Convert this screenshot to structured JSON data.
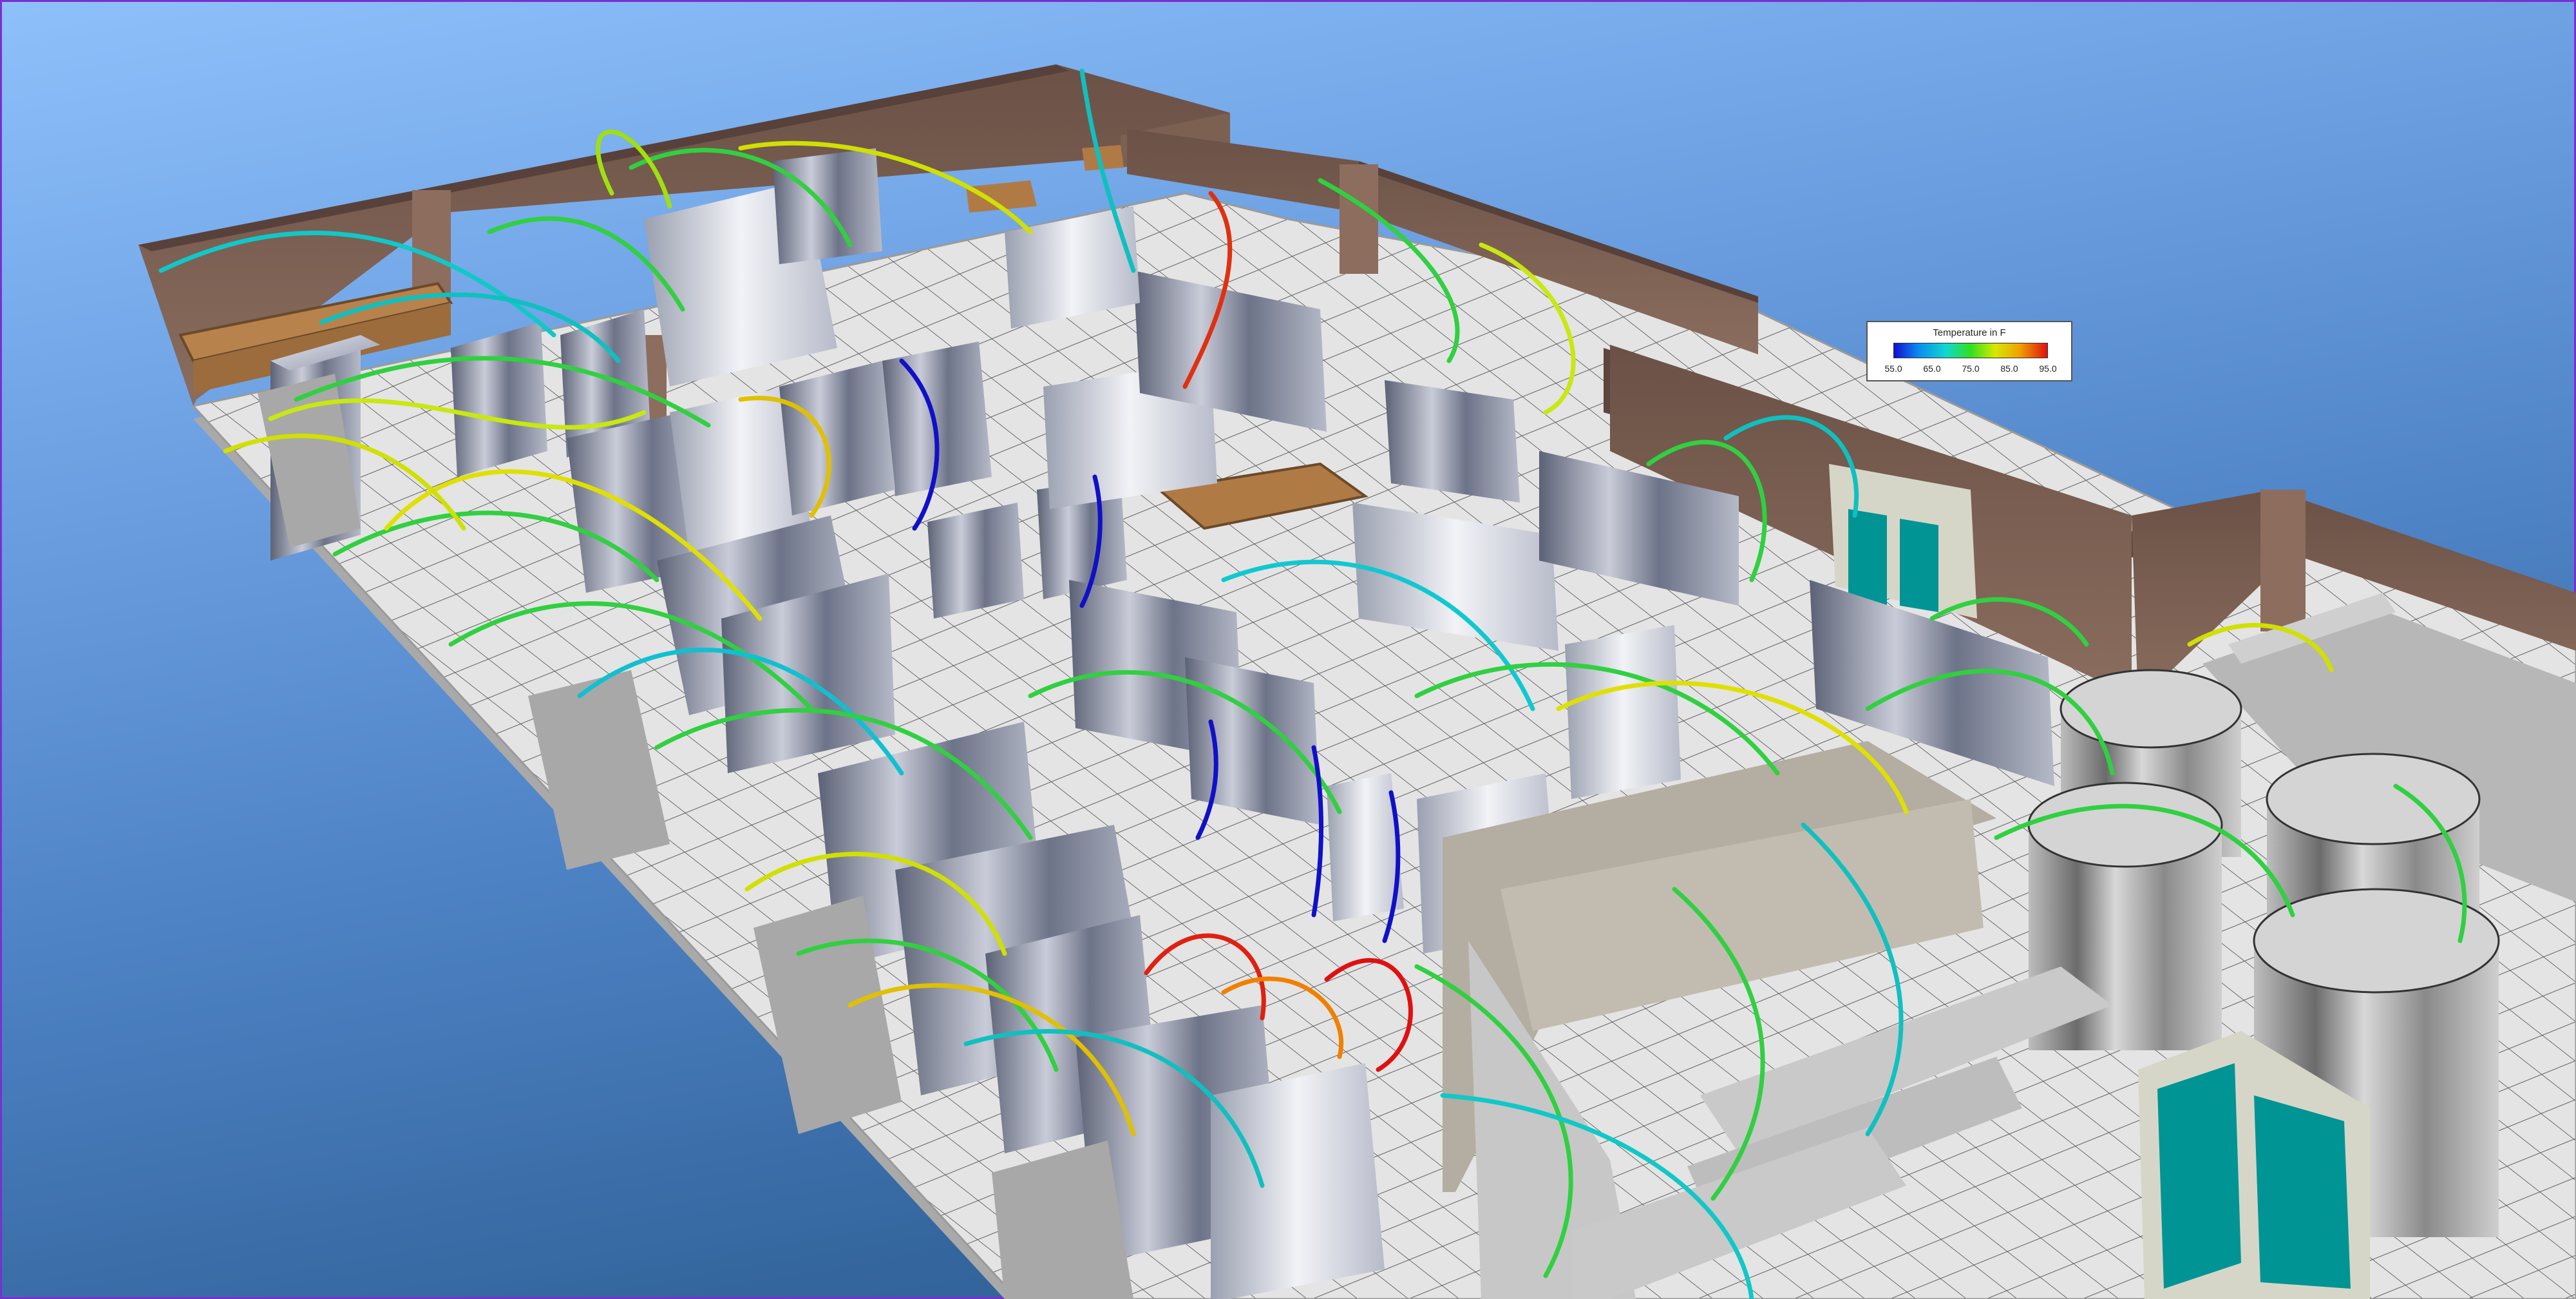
{
  "legend": {
    "title": "Temperature in F",
    "ticks": [
      "55.0",
      "65.0",
      "75.0",
      "85.0",
      "95.0"
    ],
    "range": [
      55.0,
      95.0
    ],
    "colors": [
      "#1010d0",
      "#0a8cf0",
      "#10d8d0",
      "#30e020",
      "#d8e800",
      "#f0a000",
      "#e01010"
    ]
  },
  "scene": {
    "floor_color": "#dcdcdc",
    "wall_color": "#7a5f52",
    "rack_color": "#8c93a6",
    "door_color": "#009494",
    "furniture_color": "#b07a45"
  }
}
